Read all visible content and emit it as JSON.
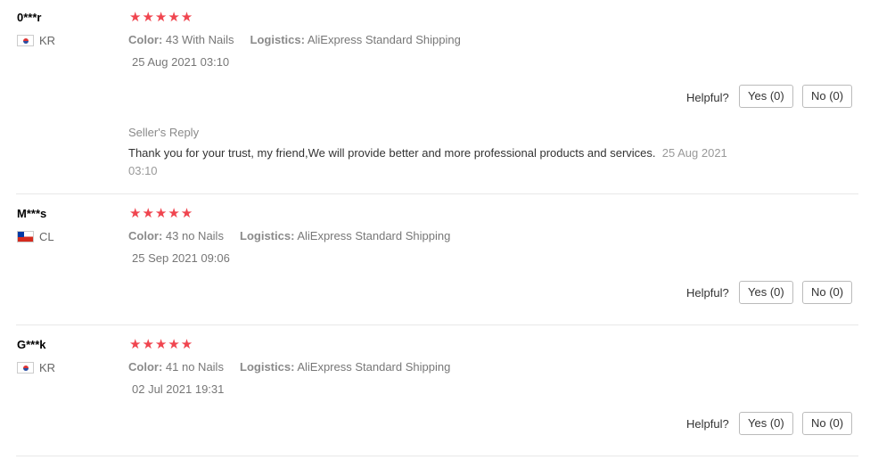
{
  "labels": {
    "color": "Color:",
    "logistics": "Logistics:",
    "helpful": "Helpful?",
    "seller_reply": "Seller's Reply"
  },
  "reviews": [
    {
      "user": "0***r",
      "country": "KR",
      "flag": "kr-flag-icon",
      "rating": 5,
      "stars": "★★★★★",
      "color_value": "43 With Nails",
      "logistics_value": "AliExpress Standard Shipping",
      "date": "25 Aug 2021 03:10",
      "yes": "Yes (0)",
      "no": "No (0)",
      "reply": {
        "text": "Thank you for your trust, my friend,We will provide better and more professional products and services.",
        "date": "25 Aug 2021 03:10"
      }
    },
    {
      "user": "M***s",
      "country": "CL",
      "flag": "cl-flag-icon",
      "rating": 5,
      "stars": "★★★★★",
      "color_value": "43 no Nails",
      "logistics_value": "AliExpress Standard Shipping",
      "date": "25 Sep 2021 09:06",
      "yes": "Yes (0)",
      "no": "No (0)"
    },
    {
      "user": "G***k",
      "country": "KR",
      "flag": "kr-flag-icon",
      "rating": 5,
      "stars": "★★★★★",
      "color_value": "41 no Nails",
      "logistics_value": "AliExpress Standard Shipping",
      "date": "02 Jul 2021 19:31",
      "yes": "Yes (0)",
      "no": "No (0)"
    }
  ],
  "colors": {
    "star": "#f0454f",
    "muted": "#8a8a8a",
    "border": "#bbbbbb"
  }
}
